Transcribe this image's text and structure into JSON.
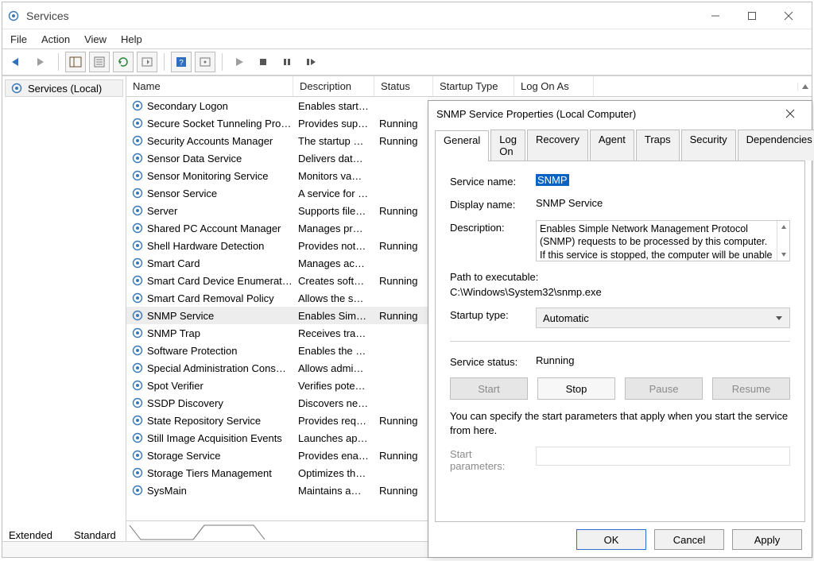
{
  "window": {
    "title": "Services",
    "menubar": [
      "File",
      "Action",
      "View",
      "Help"
    ],
    "nav_item": "Services (Local)",
    "columns": [
      "Name",
      "Description",
      "Status",
      "Startup Type",
      "Log On As"
    ],
    "view_tabs": [
      "Extended",
      "Standard"
    ]
  },
  "services": [
    {
      "name": "Secondary Logon",
      "desc": "Enables start…",
      "status": ""
    },
    {
      "name": "Secure Socket Tunneling Pro…",
      "desc": "Provides sup…",
      "status": "Running"
    },
    {
      "name": "Security Accounts Manager",
      "desc": "The startup …",
      "status": "Running"
    },
    {
      "name": "Sensor Data Service",
      "desc": "Delivers dat…",
      "status": ""
    },
    {
      "name": "Sensor Monitoring Service",
      "desc": "Monitors va…",
      "status": ""
    },
    {
      "name": "Sensor Service",
      "desc": "A service for …",
      "status": ""
    },
    {
      "name": "Server",
      "desc": "Supports file…",
      "status": "Running"
    },
    {
      "name": "Shared PC Account Manager",
      "desc": "Manages pr…",
      "status": ""
    },
    {
      "name": "Shell Hardware Detection",
      "desc": "Provides not…",
      "status": "Running"
    },
    {
      "name": "Smart Card",
      "desc": "Manages ac…",
      "status": ""
    },
    {
      "name": "Smart Card Device Enumerat…",
      "desc": "Creates soft…",
      "status": "Running"
    },
    {
      "name": "Smart Card Removal Policy",
      "desc": "Allows the s…",
      "status": ""
    },
    {
      "name": "SNMP Service",
      "desc": "Enables Sim…",
      "status": "Running",
      "selected": true
    },
    {
      "name": "SNMP Trap",
      "desc": "Receives tra…",
      "status": ""
    },
    {
      "name": "Software Protection",
      "desc": "Enables the …",
      "status": ""
    },
    {
      "name": "Special Administration Cons…",
      "desc": "Allows admi…",
      "status": ""
    },
    {
      "name": "Spot Verifier",
      "desc": "Verifies pote…",
      "status": ""
    },
    {
      "name": "SSDP Discovery",
      "desc": "Discovers ne…",
      "status": ""
    },
    {
      "name": "State Repository Service",
      "desc": "Provides req…",
      "status": "Running"
    },
    {
      "name": "Still Image Acquisition Events",
      "desc": "Launches ap…",
      "status": ""
    },
    {
      "name": "Storage Service",
      "desc": "Provides ena…",
      "status": "Running"
    },
    {
      "name": "Storage Tiers Management",
      "desc": "Optimizes th…",
      "status": ""
    },
    {
      "name": "SysMain",
      "desc": "Maintains a…",
      "status": "Running"
    }
  ],
  "dialog": {
    "title": "SNMP Service Properties (Local Computer)",
    "tabs": [
      "General",
      "Log On",
      "Recovery",
      "Agent",
      "Traps",
      "Security",
      "Dependencies"
    ],
    "active_tab": "General",
    "labels": {
      "service_name": "Service name:",
      "display_name": "Display name:",
      "description": "Description:",
      "path": "Path to executable:",
      "startup_type": "Startup type:",
      "service_status": "Service status:",
      "start_params": "Start parameters:"
    },
    "values": {
      "service_name": "SNMP",
      "display_name": "SNMP Service",
      "description": "Enables Simple Network Management Protocol (SNMP) requests to be processed by this computer. If this service is stopped, the computer will be unable",
      "path": "C:\\Windows\\System32\\snmp.exe",
      "startup_type": "Automatic",
      "service_status": "Running"
    },
    "svc_buttons": {
      "start": "Start",
      "stop": "Stop",
      "pause": "Pause",
      "resume": "Resume"
    },
    "hint": "You can specify the start parameters that apply when you start the service from here.",
    "footer": {
      "ok": "OK",
      "cancel": "Cancel",
      "apply": "Apply"
    }
  }
}
